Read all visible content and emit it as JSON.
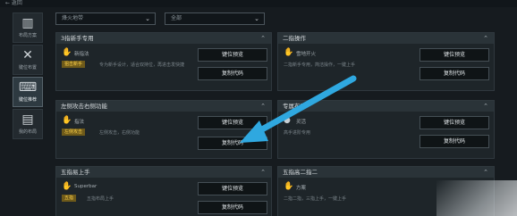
{
  "window": {
    "back_label": "← 返回"
  },
  "sidebar": {
    "items": [
      {
        "label": "布局方案",
        "icon": "book-icon"
      },
      {
        "label": "键位布置",
        "icon": "crossed-swords-icon"
      },
      {
        "label": "键位推荐",
        "icon": "keyboard-icon"
      },
      {
        "label": "我的布局",
        "icon": "document-icon"
      }
    ]
  },
  "filters": {
    "mode_value": "烽火地带",
    "type_value": "全部"
  },
  "cards": [
    {
      "title": "3指新手专用",
      "name": "新指法",
      "tag": "狙击新手",
      "desc": "专为新手设计，适合双持位，再进击发快捷",
      "buttons": [
        "键位预览",
        "复制代码"
      ]
    },
    {
      "title": "二指操作",
      "name": "雪地开火",
      "desc": "二指新手专用，简洁操作，一键上手",
      "buttons": [
        "键位预览",
        "复制代码"
      ]
    },
    {
      "title": "左侧攻击右侧功能",
      "name": "指法",
      "tag": "左侧攻击",
      "desc": "左侧攻击，右侧功能",
      "buttons": [
        "键位预览",
        "复制代码"
      ]
    },
    {
      "title": "专属布局",
      "name": "灵活",
      "desc": "高手进阶专用",
      "buttons": [
        "键位预览",
        "复制代码"
      ]
    },
    {
      "title": "五指易上手",
      "name": "Superbar",
      "tag": "五指",
      "desc": "五指布局上手",
      "buttons": [
        "键位预览",
        "复制代码"
      ]
    },
    {
      "title": "五指高二指二",
      "name": "方案",
      "desc": "二指二指，三指上手，一键上手",
      "buttons": []
    }
  ],
  "colors": {
    "background": "#161b1f",
    "card": "#1e2529",
    "header": "#2a3338",
    "tag_text": "#ffd24a",
    "arrow": "#2fa8e0"
  }
}
